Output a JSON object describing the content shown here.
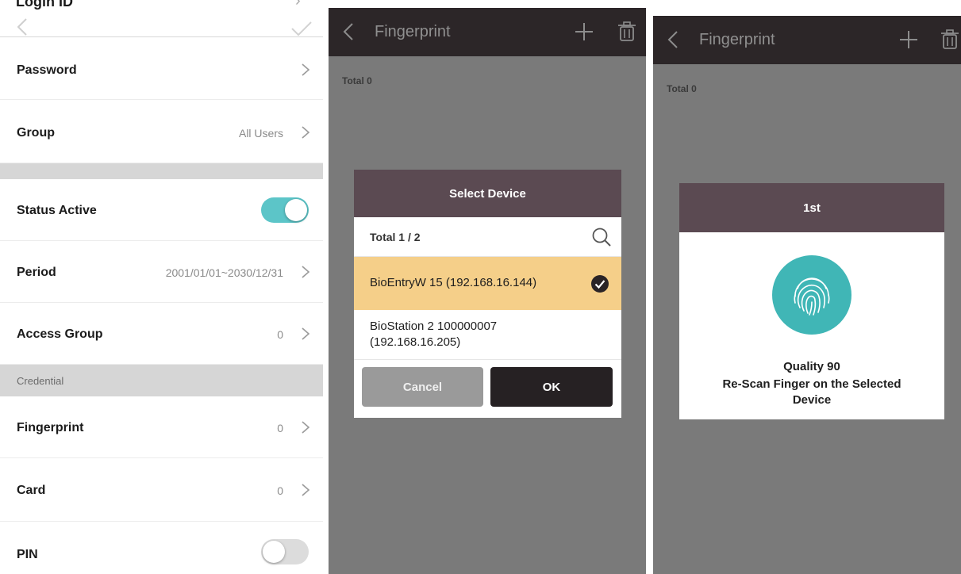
{
  "screen1": {
    "header": {
      "title": "Login ID"
    },
    "rows": {
      "password": {
        "label": "Password"
      },
      "group": {
        "label": "Group",
        "value": "All Users"
      },
      "status_active": {
        "label": "Status Active",
        "enabled": true
      },
      "period": {
        "label": "Period",
        "value": "2001/01/01~2030/12/31"
      },
      "access_group": {
        "label": "Access Group",
        "value": "0"
      },
      "credential_section": {
        "label": "Credential"
      },
      "fingerprint": {
        "label": "Fingerprint",
        "value": "0"
      },
      "card": {
        "label": "Card",
        "value": "0"
      },
      "pin": {
        "label": "PIN",
        "enabled": false
      }
    }
  },
  "screen2": {
    "header": {
      "title": "Fingerprint"
    },
    "total": "Total  0",
    "dialog": {
      "title": "Select Device",
      "total": "Total  1 / 2",
      "devices": [
        {
          "line1": "BioEntryW 15 (192.168.16.144)",
          "line2": "",
          "selected": true
        },
        {
          "line1": "BioStation 2 100000007",
          "line2": "(192.168.16.205)",
          "selected": false
        }
      ],
      "cancel_label": "Cancel",
      "ok_label": "OK"
    }
  },
  "screen3": {
    "header": {
      "title": "Fingerprint"
    },
    "total": "Total  0",
    "dialog": {
      "title": "1st",
      "quality": "Quality 90",
      "message_line1": "Re-Scan Finger on the Selected",
      "message_line2": "Device"
    }
  },
  "colors": {
    "appbar": "#2c2628",
    "dialog_header": "#5b4a52",
    "toggle_on": "#5cc5c8",
    "selected_row": "#f5cf89",
    "fingerprint_accent": "#40b6b6"
  },
  "icons": [
    "back-arrow-icon",
    "checkmark-icon",
    "chevron-right-icon",
    "plus-icon",
    "trash-icon",
    "search-icon",
    "check-circle-icon",
    "fingerprint-icon"
  ]
}
